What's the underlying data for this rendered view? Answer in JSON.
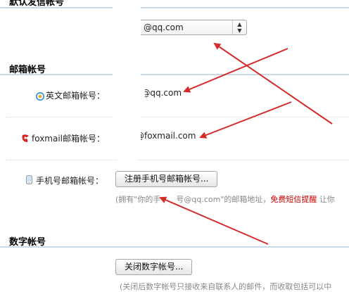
{
  "sections": {
    "default_sender": {
      "title": "默认发信帐号"
    },
    "mail_accounts": {
      "title": "邮箱帐号"
    },
    "digital_accounts": {
      "title": "数字帐号"
    }
  },
  "default_sender": {
    "selected_value": "@qq.com"
  },
  "mail_accounts": {
    "english": {
      "label": "英文邮箱帐号：",
      "value": "i@qq.com"
    },
    "foxmail": {
      "label": "foxmail邮箱帐号：",
      "value": "@foxmail.com"
    },
    "mobile": {
      "label": "手机号邮箱帐号：",
      "button_label": "注册手机号邮箱帐号...",
      "hint_prefix": "(拥有\"你的手",
      "hint_middle": "号@qq.com\"的邮箱地址，",
      "hint_red": "免费短信提醒",
      "hint_suffix": " 让你"
    }
  },
  "digital": {
    "button_label": "关闭数字帐号...",
    "hint": "(关闭后数字帐号只接收来自联系人的邮件，而收取包括可以中"
  },
  "colors": {
    "section_line": "#c8d9ea",
    "arrow": "#d42b2b",
    "hint_red": "#cc0000"
  }
}
